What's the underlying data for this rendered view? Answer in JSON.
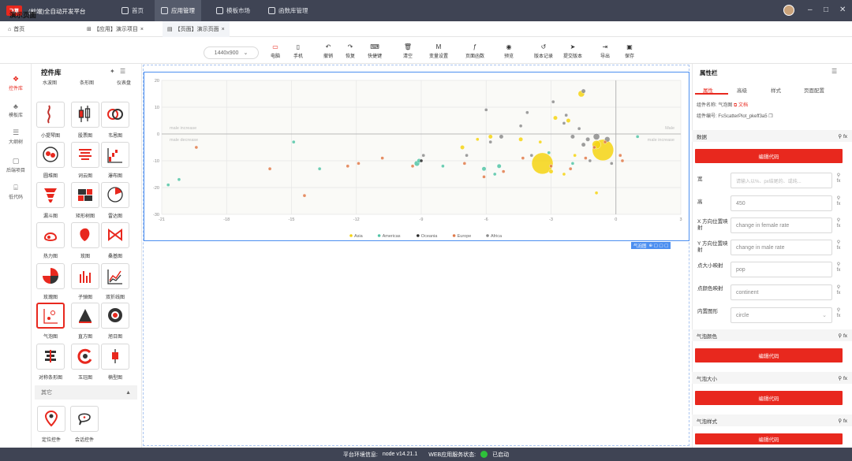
{
  "app": {
    "logo": "飞算",
    "title": "(前端)全自动开发平台"
  },
  "topnav": [
    {
      "label": "首页",
      "icon": "home-icon"
    },
    {
      "label": "应用管理",
      "icon": "grid-icon",
      "active": true
    },
    {
      "label": "模板市场",
      "icon": "template-icon"
    },
    {
      "label": "函数库管理",
      "icon": "function-icon"
    }
  ],
  "window_controls": {
    "minimize": "–",
    "maximize": "□",
    "close": "✕"
  },
  "tabs": [
    {
      "label": "首页",
      "icon": "home-icon"
    },
    {
      "label": "【应用】演示项目",
      "icon": "grid-icon",
      "closable": true
    },
    {
      "label": "【页面】演示页面",
      "icon": "page-icon",
      "closable": true,
      "active": true
    }
  ],
  "page": {
    "title": "演示页面",
    "size_select": "1440x900"
  },
  "toolbar": [
    {
      "label": "电脑",
      "glyph": "▭",
      "active": true
    },
    {
      "label": "手机",
      "glyph": "▯"
    },
    {
      "label": "撤销",
      "glyph": "↶"
    },
    {
      "label": "恢复",
      "glyph": "↷"
    },
    {
      "label": "快捷键",
      "glyph": "⌨"
    },
    {
      "label": "清空",
      "glyph": "🗑"
    },
    {
      "label": "变量设置",
      "glyph": "M"
    },
    {
      "label": "页面函数",
      "glyph": "ƒ"
    },
    {
      "label": "预览",
      "glyph": "◉"
    },
    {
      "label": "版本记录",
      "glyph": "↺"
    },
    {
      "label": "提交版本",
      "glyph": "➤"
    },
    {
      "label": "导出",
      "glyph": "⇥"
    },
    {
      "label": "保存",
      "glyph": "▣"
    }
  ],
  "rail": [
    {
      "label": "控件库",
      "glyph": "❖",
      "active": true
    },
    {
      "label": "模板库",
      "glyph": "♣"
    },
    {
      "label": "大纲树",
      "glyph": "☰"
    },
    {
      "label": "后端项目",
      "glyph": "▢"
    },
    {
      "label": "低代码",
      "glyph": "⌸"
    }
  ],
  "library": {
    "title": "控件库",
    "pin": "✦",
    "menu": "☰",
    "top_labels": [
      "水波图",
      "条形图",
      "仪表盘"
    ],
    "items": [
      {
        "label": "小提琴图",
        "icon": "violin-icon"
      },
      {
        "label": "股票图",
        "icon": "candlestick-icon"
      },
      {
        "label": "韦恩图",
        "icon": "venn-icon"
      },
      {
        "label": "圆堆图",
        "icon": "circle-pack-icon"
      },
      {
        "label": "词云图",
        "icon": "word-cloud-icon"
      },
      {
        "label": "瀑布图",
        "icon": "waterfall-icon"
      },
      {
        "label": "漏斗图",
        "icon": "funnel-icon"
      },
      {
        "label": "矩形树图",
        "icon": "treemap-icon"
      },
      {
        "label": "雷达图",
        "icon": "radar-icon"
      },
      {
        "label": "热力图",
        "icon": "heatmap-icon"
      },
      {
        "label": "玫图",
        "icon": "rose-icon"
      },
      {
        "label": "桑基图",
        "icon": "sankey-icon"
      },
      {
        "label": "玫瑰图",
        "icon": "rose-chart-icon"
      },
      {
        "label": "子弹图",
        "icon": "bullet-icon"
      },
      {
        "label": "双折线图",
        "icon": "dual-line-icon"
      },
      {
        "label": "气泡图",
        "icon": "bubble-icon",
        "selected": true
      },
      {
        "label": "直方图",
        "icon": "histogram-icon"
      },
      {
        "label": "旭日图",
        "icon": "sunburst-icon"
      },
      {
        "label": "对称条形图",
        "icon": "symmetric-bar-icon"
      },
      {
        "label": "玉珏图",
        "icon": "radial-bar-icon"
      },
      {
        "label": "楠型图",
        "icon": "box-plot-icon"
      }
    ],
    "group": {
      "label": "其它",
      "arrow": "▲"
    },
    "other_items": [
      {
        "label": "定位控件",
        "icon": "location-icon"
      },
      {
        "label": "会话控件",
        "icon": "chat-icon"
      }
    ]
  },
  "canvas": {
    "badge": "气泡图",
    "badge_tools": "⊕ ▢ ▢ ▢"
  },
  "chart_data": {
    "type": "scatter",
    "x_ticks": [
      "-21",
      "-18",
      "-15",
      "-12",
      "-9",
      "-6",
      "-3",
      "0",
      "3"
    ],
    "y_ticks": [
      "20",
      "10",
      "0",
      "-10",
      "-20",
      "-30"
    ],
    "xlim": [
      -21,
      3
    ],
    "ylim": [
      -30,
      20
    ],
    "grid": true,
    "legend_position": "bottom",
    "annotations": [
      "male increase",
      "male decrease",
      "Male",
      "male increase"
    ],
    "series": [
      {
        "name": "Asia",
        "color": "#f5d313",
        "points": [
          {
            "x": -1.6,
            "y": 15,
            "size": 3
          },
          {
            "x": -2.8,
            "y": 6,
            "size": 2
          },
          {
            "x": -2.2,
            "y": 5,
            "size": 2
          },
          {
            "x": -3.4,
            "y": -11,
            "size": 10
          },
          {
            "x": -0.6,
            "y": -6,
            "size": 10
          },
          {
            "x": -0.9,
            "y": -4,
            "size": 4
          },
          {
            "x": -4.4,
            "y": -2,
            "size": 2
          },
          {
            "x": -6.4,
            "y": -2,
            "size": 1.5
          },
          {
            "x": -7.1,
            "y": -5,
            "size": 2
          },
          {
            "x": -2.4,
            "y": -15,
            "size": 1.5
          },
          {
            "x": -0.9,
            "y": -22,
            "size": 1.5
          },
          {
            "x": -3.0,
            "y": -14,
            "size": 2
          },
          {
            "x": -5.8,
            "y": -1,
            "size": 2
          },
          {
            "x": -1.9,
            "y": -8,
            "size": 1.5
          },
          {
            "x": -3.5,
            "y": -3,
            "size": 1.5
          }
        ]
      },
      {
        "name": "Americas",
        "color": "#52c4a6",
        "points": [
          {
            "x": -20.7,
            "y": -19,
            "size": 1.5
          },
          {
            "x": -20.2,
            "y": -17,
            "size": 1.5
          },
          {
            "x": -14.9,
            "y": -3,
            "size": 1.5
          },
          {
            "x": -13.7,
            "y": -13,
            "size": 1.5
          },
          {
            "x": -9.2,
            "y": -11,
            "size": 2.5
          },
          {
            "x": -9.1,
            "y": -10,
            "size": 2
          },
          {
            "x": -8.0,
            "y": -12,
            "size": 1.5
          },
          {
            "x": -6.1,
            "y": -13,
            "size": 2
          },
          {
            "x": -5.6,
            "y": -15,
            "size": 1.5
          },
          {
            "x": -5.4,
            "y": -12,
            "size": 2
          },
          {
            "x": -2.0,
            "y": -11,
            "size": 1.5
          },
          {
            "x": -3.1,
            "y": -7,
            "size": 1.5
          },
          {
            "x": 1.0,
            "y": -1,
            "size": 1.5
          }
        ]
      },
      {
        "name": "Oceania",
        "color": "#2b2b2b",
        "points": [
          {
            "x": -9.0,
            "y": -10,
            "size": 1.5
          }
        ]
      },
      {
        "name": "Europe",
        "color": "#e07b4b",
        "points": [
          {
            "x": -19.4,
            "y": -5,
            "size": 1.5
          },
          {
            "x": -16.0,
            "y": -13,
            "size": 1.5
          },
          {
            "x": -14.4,
            "y": -23,
            "size": 1.5
          },
          {
            "x": -12.4,
            "y": -12,
            "size": 1.5
          },
          {
            "x": -11.9,
            "y": -11,
            "size": 1.5
          },
          {
            "x": -10.8,
            "y": -9,
            "size": 1.5
          },
          {
            "x": -9.4,
            "y": -12,
            "size": 1.5
          },
          {
            "x": -7.0,
            "y": -11,
            "size": 1.5
          },
          {
            "x": -6.1,
            "y": -16,
            "size": 1.5
          },
          {
            "x": -5.2,
            "y": -14,
            "size": 1.5
          },
          {
            "x": -4.3,
            "y": -9,
            "size": 1.5
          },
          {
            "x": -3.0,
            "y": -12,
            "size": 1.5
          },
          {
            "x": -2.1,
            "y": -13,
            "size": 1.5
          },
          {
            "x": -1.4,
            "y": -9,
            "size": 1.5
          },
          {
            "x": -1.0,
            "y": -5,
            "size": 1.5
          },
          {
            "x": -0.5,
            "y": -3,
            "size": 1.5
          },
          {
            "x": 0.2,
            "y": -8,
            "size": 1.5
          },
          {
            "x": 0.3,
            "y": -10,
            "size": 1.5
          }
        ]
      },
      {
        "name": "Africa",
        "color": "#8c8c8c",
        "points": [
          {
            "x": -6.0,
            "y": 9,
            "size": 1.5
          },
          {
            "x": -5.8,
            "y": -3,
            "size": 1.5
          },
          {
            "x": -5.3,
            "y": -1,
            "size": 2
          },
          {
            "x": -4.4,
            "y": 3,
            "size": 1.5
          },
          {
            "x": -4.1,
            "y": 8,
            "size": 1.5
          },
          {
            "x": -2.9,
            "y": 12,
            "size": 1.5
          },
          {
            "x": -2.4,
            "y": 4,
            "size": 1.5
          },
          {
            "x": -2.3,
            "y": 7,
            "size": 1.5
          },
          {
            "x": -2.0,
            "y": -1,
            "size": 2
          },
          {
            "x": -1.5,
            "y": -4,
            "size": 2
          },
          {
            "x": -1.3,
            "y": -2,
            "size": 2
          },
          {
            "x": -1.2,
            "y": -10,
            "size": 1.5
          },
          {
            "x": -0.9,
            "y": -1,
            "size": 3
          },
          {
            "x": -0.4,
            "y": -2,
            "size": 2.5
          },
          {
            "x": -1.5,
            "y": 16,
            "size": 2
          },
          {
            "x": -3.9,
            "y": -8,
            "size": 1.5
          },
          {
            "x": -6.9,
            "y": -8,
            "size": 1.5
          },
          {
            "x": -8.9,
            "y": -8,
            "size": 1.5
          },
          {
            "x": -1.7,
            "y": 2,
            "size": 1.5
          },
          {
            "x": -0.2,
            "y": -11,
            "size": 1.5
          }
        ]
      }
    ]
  },
  "props": {
    "title": "属性栏",
    "menu": "☰",
    "tabs": [
      "属性",
      "高级",
      "样式",
      "页面配置"
    ],
    "name_label": "组件名称:",
    "name_value": "气泡图",
    "doc_link": "文档",
    "id_label": "组件编号:",
    "id_value": "FsScatterPlot_pkeff3a5",
    "sections": {
      "data": "数据",
      "bubble_color": "气泡颜色",
      "bubble_size": "气泡大小",
      "bubble_style": "气泡样式"
    },
    "edit_code": "编辑代码",
    "fields": [
      {
        "label": "宽",
        "value": "",
        "placeholder": "请输入以%、px结尾的、或纯..."
      },
      {
        "label": "高",
        "value": "450"
      },
      {
        "label": "X 方向位置映射",
        "value": "change in female rate"
      },
      {
        "label": "Y 方向位置映射",
        "value": "change in male rate"
      },
      {
        "label": "点大小映射",
        "value": "pop"
      },
      {
        "label": "点颜色映射",
        "value": "continent"
      },
      {
        "label": "内置图形",
        "value": "circle",
        "select": true
      }
    ]
  },
  "status": {
    "env_label": "平台环境信息:",
    "env_value": "node v14.21.1",
    "service_label": "WEB应用服务状态:",
    "service_value": "已启动"
  }
}
